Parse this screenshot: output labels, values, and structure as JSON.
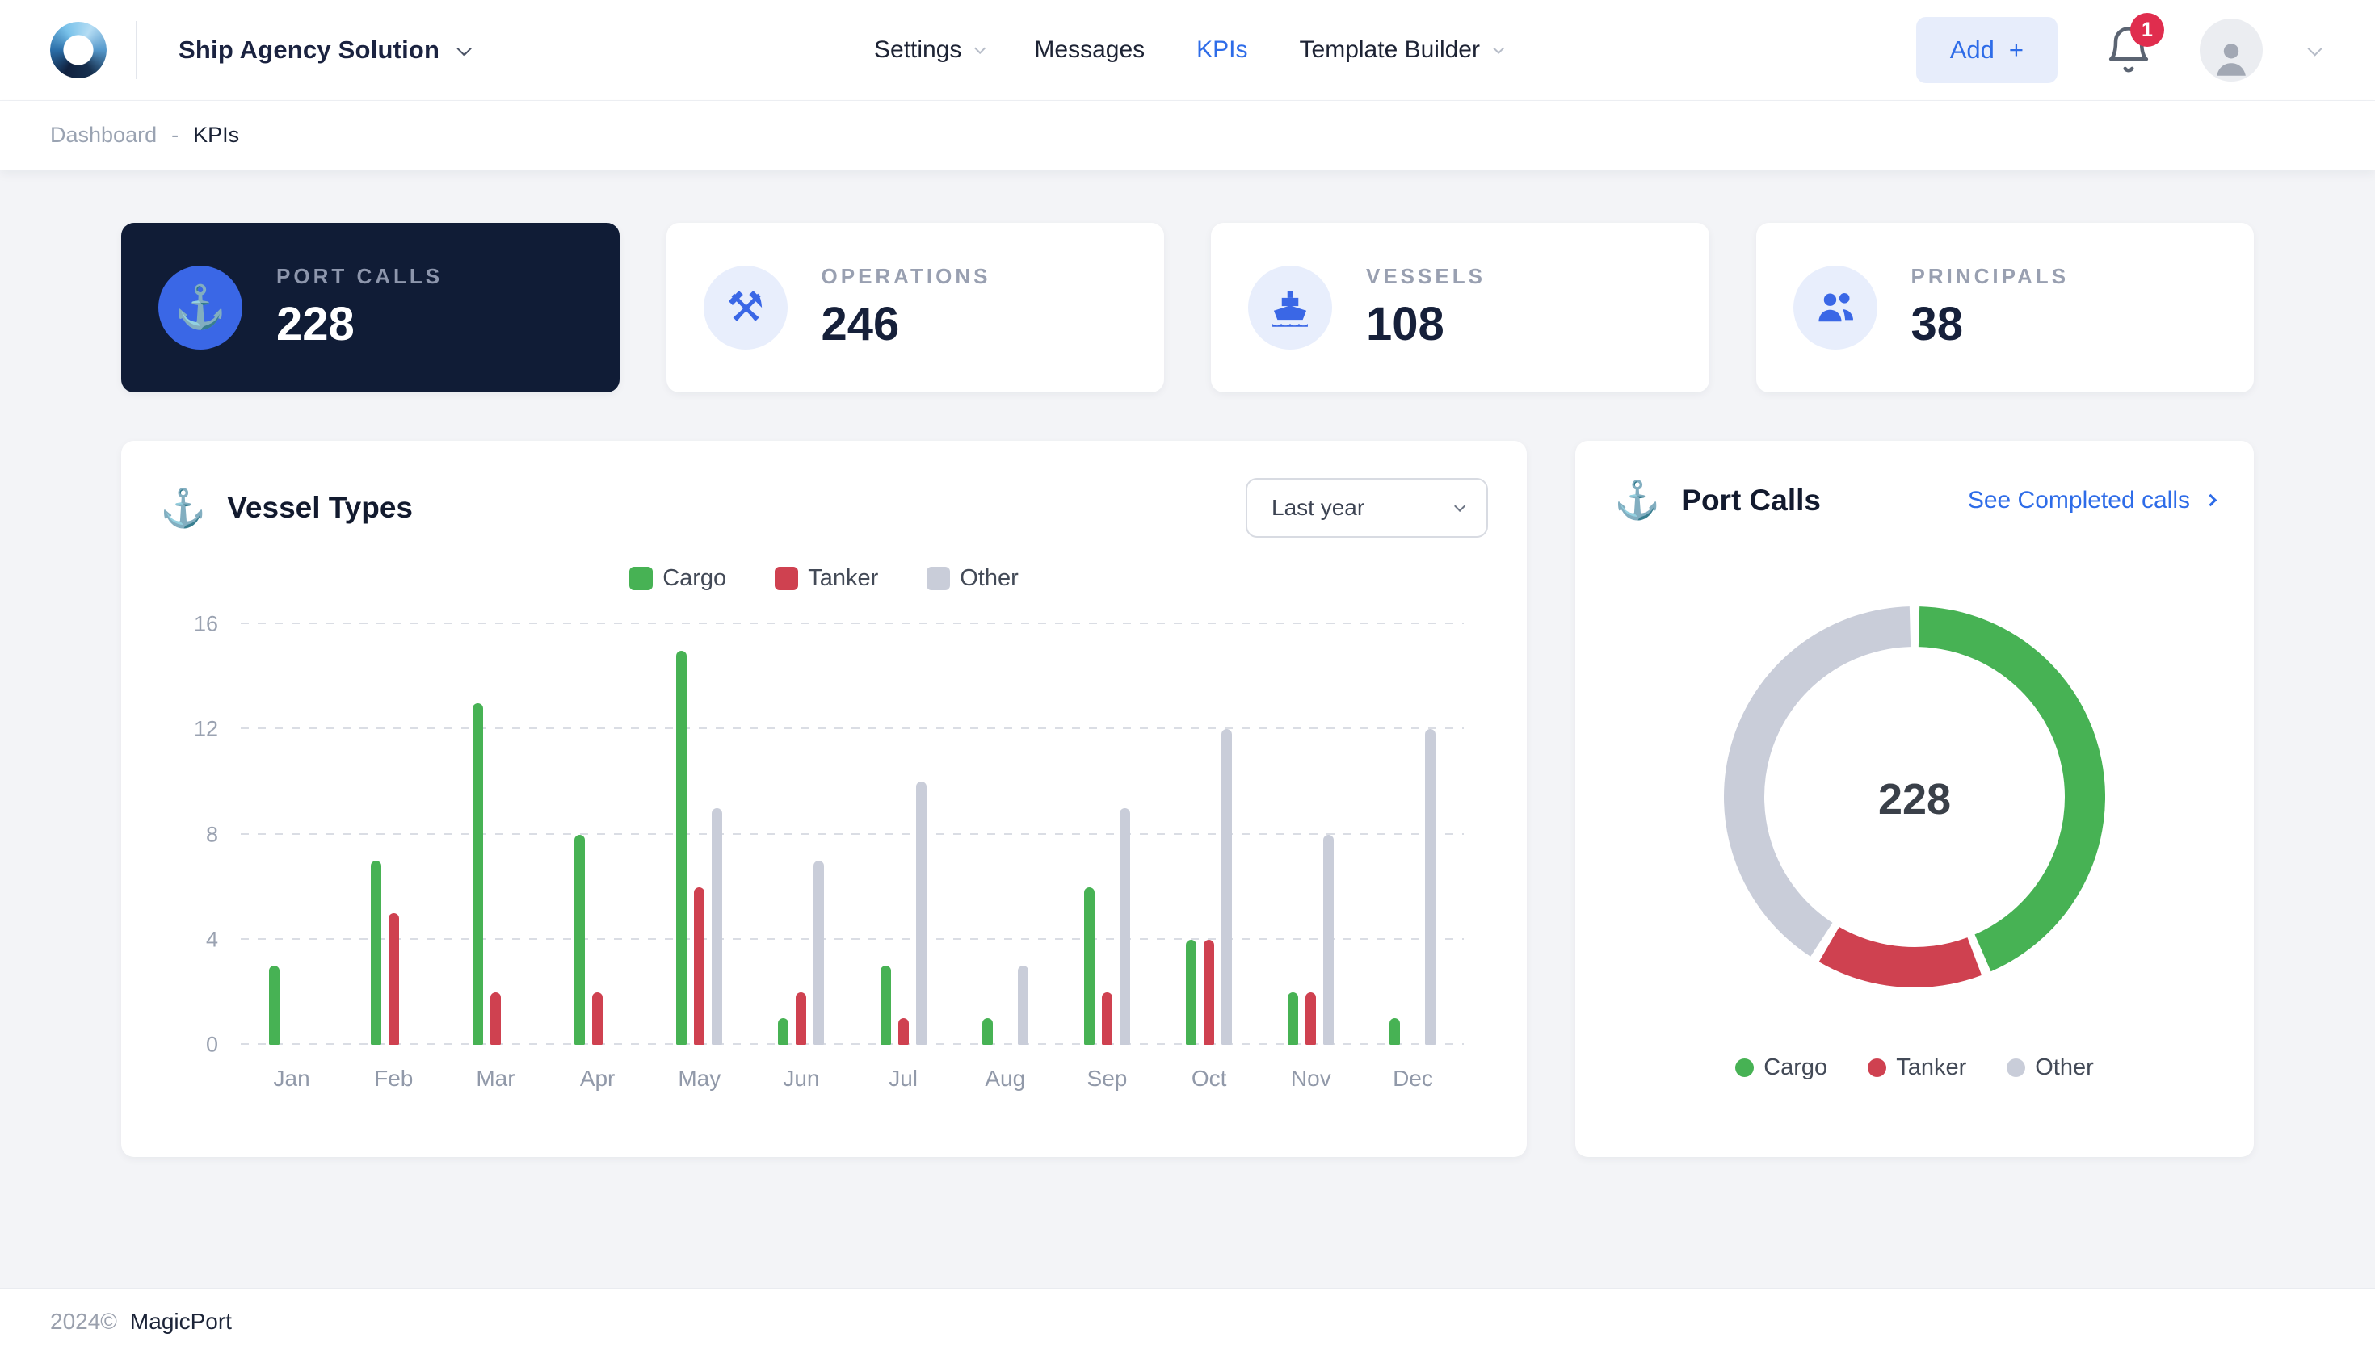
{
  "colors": {
    "primary": "#2e6ce8",
    "cargo": "#47b254",
    "tanker": "#cf4150",
    "other": "#c9cdd9",
    "dark_card": "#101c36",
    "badge": "#e02d4e"
  },
  "header": {
    "brand": "Ship Agency Solution",
    "nav_items": [
      {
        "label": "Settings",
        "has_dropdown": true,
        "active": false
      },
      {
        "label": "Messages",
        "has_dropdown": false,
        "active": false
      },
      {
        "label": "KPIs",
        "has_dropdown": false,
        "active": true
      },
      {
        "label": "Template Builder",
        "has_dropdown": true,
        "active": false
      }
    ],
    "add_label": "Add",
    "add_icon": "+",
    "notification_count": "1"
  },
  "breadcrumb": {
    "parent": "Dashboard",
    "separator": "-",
    "current": "KPIs"
  },
  "kpi_cards": [
    {
      "label": "PORT CALLS",
      "value": "228",
      "icon": "anchor-icon",
      "dark": true
    },
    {
      "label": "OPERATIONS",
      "value": "246",
      "icon": "tools-icon",
      "dark": false
    },
    {
      "label": "VESSELS",
      "value": "108",
      "icon": "ship-icon",
      "dark": false
    },
    {
      "label": "PRINCIPALS",
      "value": "38",
      "icon": "people-icon",
      "dark": false
    }
  ],
  "vessel_types_card": {
    "title": "Vessel Types",
    "icon": "anchor-icon",
    "period_selected": "Last year",
    "chart_data": {
      "type": "bar",
      "categories": [
        "Jan",
        "Feb",
        "Mar",
        "Apr",
        "May",
        "Jun",
        "Jul",
        "Aug",
        "Sep",
        "Oct",
        "Nov",
        "Dec"
      ],
      "series": [
        {
          "name": "Cargo",
          "color_key": "cargo",
          "values": [
            3,
            7,
            13,
            8,
            15,
            1,
            3,
            1,
            6,
            4,
            2,
            1
          ]
        },
        {
          "name": "Tanker",
          "color_key": "tanker",
          "values": [
            0,
            5,
            2,
            2,
            6,
            2,
            1,
            0,
            2,
            4,
            2,
            0
          ]
        },
        {
          "name": "Other",
          "color_key": "other",
          "values": [
            0,
            0,
            0,
            0,
            9,
            7,
            10,
            3,
            9,
            12,
            8,
            12
          ]
        }
      ],
      "ylim": [
        0,
        16
      ],
      "yticks": [
        0,
        4,
        8,
        12,
        16
      ],
      "grid": "dashed-horizontal",
      "legend_position": "top"
    }
  },
  "port_calls_card": {
    "title": "Port Calls",
    "icon": "anchor-icon",
    "link_label": "See Completed calls",
    "chart_data": {
      "type": "pie",
      "subtype": "donut",
      "labels": [
        "Cargo",
        "Tanker",
        "Other"
      ],
      "values": [
        100,
        34,
        94
      ],
      "color_keys": [
        "cargo",
        "tanker",
        "other"
      ],
      "center_label": "228",
      "legend_position": "bottom"
    }
  },
  "footer": {
    "year": "2024©",
    "brand": "MagicPort"
  }
}
